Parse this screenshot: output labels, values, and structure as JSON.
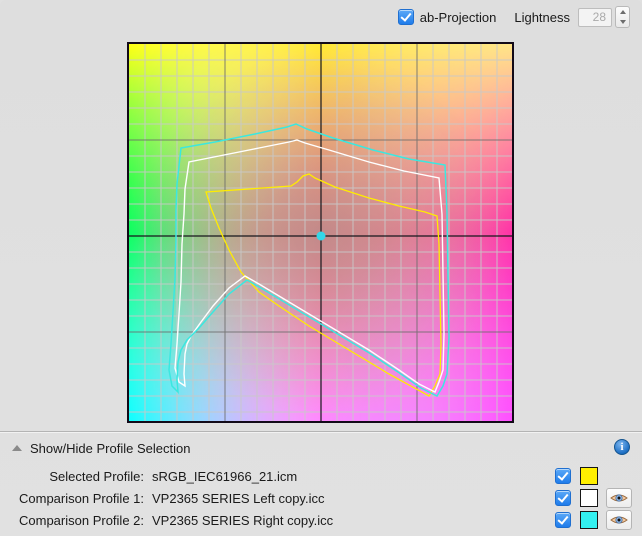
{
  "header": {
    "ab_projection": {
      "label": "ab-Projection",
      "checked": true,
      "icon": "checkbox-checked-icon"
    },
    "lightness": {
      "label": "Lightness",
      "value": "28",
      "disabled": true,
      "stepper_icon": "stepper-up-down-icon"
    }
  },
  "plot": {
    "name": "ab-projection-gamut-plot",
    "grid": {
      "minor_cells": 24,
      "major_every": 6,
      "minor_color": "#c9c9c9",
      "major_color": "#6b6b6b"
    },
    "axes": {
      "crosshair_color": "#1b1b1b",
      "center_marker_color": "#35d7e8"
    },
    "border_color": "#120a18",
    "gamuts": [
      {
        "name": "selected-profile-gamut",
        "color": "#ffec00",
        "profile": "sRGB_IEC61966_21.icm"
      },
      {
        "name": "comparison-profile-1-gamut",
        "color": "#ffffff",
        "profile": "VP2365 SERIES Left copy.icc"
      },
      {
        "name": "comparison-profile-2-gamut",
        "color": "#3ae8e0",
        "profile": "VP2365 SERIES Right copy.icc"
      }
    ]
  },
  "profile_panel": {
    "disclosure": {
      "label": "Show/Hide Profile Selection",
      "expanded": true,
      "icon": "disclosure-triangle-up-icon"
    },
    "info_icon": {
      "name": "info-icon",
      "glyph": "i"
    },
    "rows": [
      {
        "label": "Selected Profile:",
        "value": "sRGB_IEC61966_21.icm",
        "checked": true,
        "swatch_color": "#ffef00",
        "has_eye": false,
        "eye_icon": "eye-icon"
      },
      {
        "label": "Comparison Profile 1:",
        "value": "VP2365 SERIES Left copy.icc",
        "checked": true,
        "swatch_color": "#ffffff",
        "has_eye": true,
        "eye_icon": "eye-icon"
      },
      {
        "label": "Comparison Profile 2:",
        "value": "VP2365 SERIES Right copy.icc",
        "checked": true,
        "swatch_color": "#32f0f0",
        "has_eye": true,
        "eye_icon": "eye-icon"
      }
    ]
  },
  "colors": {
    "window_bg": "#e0e0e0",
    "accent_checkbox": "#1f7ceb",
    "text": "#1a1a1a"
  }
}
